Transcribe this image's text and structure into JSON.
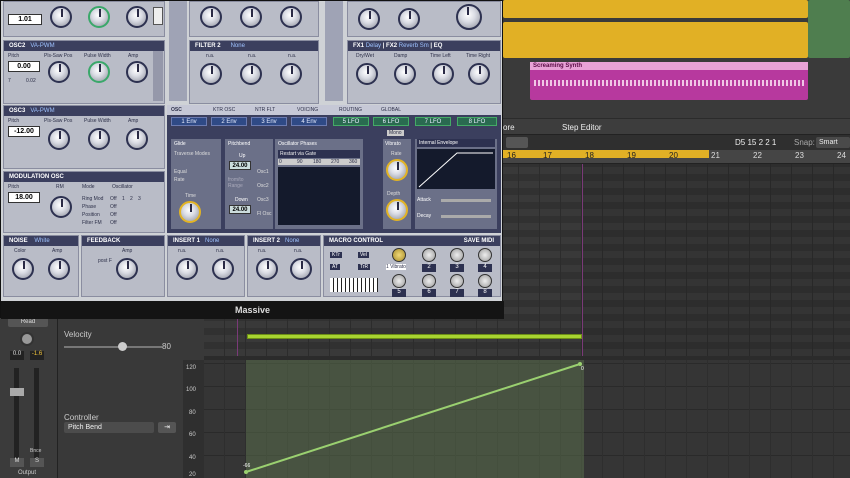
{
  "massive": {
    "title": "Massive",
    "osc2": {
      "header": "OSC2",
      "mode": "VA-PWM",
      "pitch_label": "Pitch",
      "pitch_value": "0.00",
      "pos_label": "Pls-Saw Pos",
      "width_label": "Pulse Width",
      "amp_label": "Amp",
      "fine": "7",
      "fine2": "0.02"
    },
    "osc3": {
      "header": "OSC3",
      "mode": "VA-PWM",
      "pitch_label": "Pitch",
      "pitch_value": "-12.00",
      "pos_label": "Pls-Saw Pos",
      "width_label": "Pulse Width",
      "amp_label": "Amp"
    },
    "modosc": {
      "header": "MODULATION OSC",
      "pitch_label": "Pitch",
      "pitch_value": "18.00",
      "rm_label": "RM",
      "mode_label": "Mode",
      "osc_label": "Oscillator",
      "rows": [
        "Ring Mod",
        "Phase",
        "Position",
        "Filter FM"
      ],
      "row_opts": [
        "Off",
        "Off",
        "Off",
        "Off"
      ],
      "nums": [
        "1",
        "2",
        "3"
      ]
    },
    "osc1_top": {
      "val": "1.01"
    },
    "filter2": {
      "header": "FILTER 2",
      "type": "None",
      "na1": "n.a.",
      "na2": "n.a.",
      "na3": "n.a."
    },
    "fx1": {
      "header": "FX1",
      "type": "Delay",
      "drywet": "Dry/Wet",
      "damp": "Damp",
      "timeleft": "Time Left",
      "timeright": "Time Right"
    },
    "fx2": {
      "header": "FX2",
      "type": "Reverb Sm"
    },
    "eq": {
      "header": "EQ"
    },
    "tabs": [
      "OSC",
      "KTR OSC",
      "NTR FLT",
      "VOICING",
      "ROUTING",
      "GLOBAL"
    ],
    "mod_slots": [
      "1 Env",
      "2 Env",
      "3 Env",
      "4 Env",
      "5 LFO",
      "6 LFO",
      "7 LFO",
      "8 LFO"
    ],
    "glide": {
      "label": "Glide",
      "traverse": "Traverse Modes",
      "equal": "Equal",
      "rate": "Rate",
      "time": "Time"
    },
    "pitchbend": {
      "label": "Pitchbend",
      "up": "Up",
      "up_val": "24.00",
      "fromto": "from/to Range",
      "down": "Down",
      "down_val": "24.00"
    },
    "phases": {
      "label": "Oscillator Phases",
      "restart": "Restart via Gate",
      "ticks": [
        "0",
        "90",
        "180",
        "270",
        "360"
      ],
      "rows": [
        "Osc1",
        "Osc2",
        "Osc3",
        "Fl Osc"
      ]
    },
    "vibrato": {
      "label": "Vibrato",
      "mono": "Mono",
      "rate": "Rate",
      "depth": "Depth"
    },
    "envelope": {
      "label": "Internal Envelope",
      "attack": "Attack",
      "decay": "Decay"
    },
    "noise": {
      "header": "NOISE",
      "type": "White",
      "color": "Color",
      "amp": "Amp"
    },
    "feedback": {
      "header": "FEEDBACK",
      "amp": "Amp",
      "postfilter": "post F"
    },
    "insert1": {
      "header": "INSERT 1",
      "type": "None",
      "na1": "n.a.",
      "na2": "n.a."
    },
    "insert2": {
      "header": "INSERT 2",
      "type": "None",
      "na1": "n.a.",
      "na2": "n.a."
    },
    "macro": {
      "header": "MACRO CONTROL",
      "save": "SAVE MIDI",
      "ktr": "KTr",
      "vel": "Vel",
      "at": "AT",
      "tr": "TrR",
      "knob1": "1 Vibrato",
      "nums": [
        "1",
        "2",
        "3",
        "4",
        "5",
        "6",
        "7",
        "8"
      ]
    }
  },
  "logic": {
    "track_region": "Screaming Synth",
    "step_editor": "Step Editor",
    "more": "ore",
    "position": "D5  15 2 2 1",
    "snap_label": "Snap:",
    "snap_value": "Smart",
    "ruler": [
      "16",
      "17",
      "18",
      "19",
      "20",
      "21",
      "22",
      "23",
      "24"
    ],
    "velocity_label": "Velocity",
    "velocity_value": "80",
    "controller_label": "Controller",
    "controller_value": "Pitch Bend",
    "axis": [
      "120",
      "100",
      "80",
      "60",
      "40",
      "20"
    ],
    "point_start": "-66",
    "point_end": "0",
    "strip_read": "Read",
    "strip_v1": "0.0",
    "strip_v2": "-1.6",
    "strip_m": "M",
    "strip_s": "S",
    "strip_bnce": "Bnce",
    "strip_output": "Output"
  },
  "colors": {
    "accent": "#e3b424",
    "region_pink": "#c03aa8",
    "vel_green": "#a8d431",
    "bend_line": "#9ad070"
  }
}
